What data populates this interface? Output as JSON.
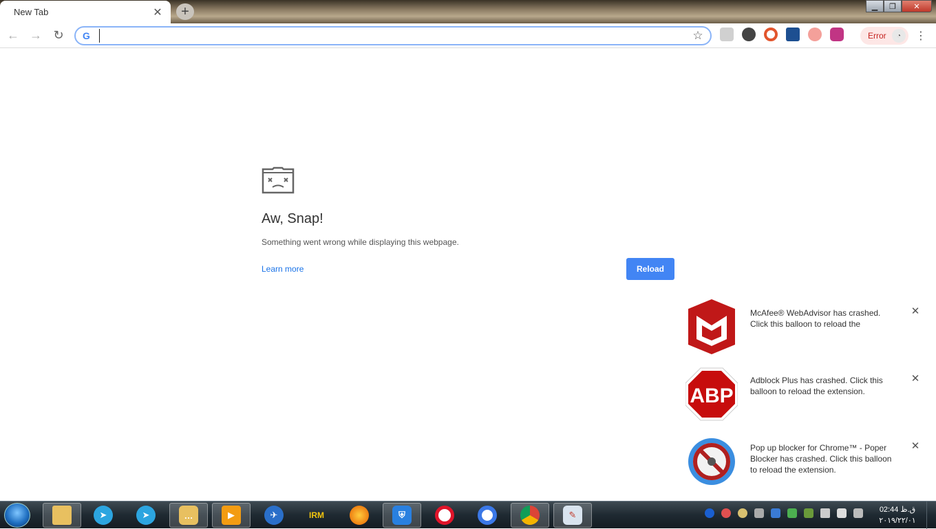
{
  "browser": {
    "tab": {
      "title": "New Tab",
      "close": "✕"
    },
    "new_tab": "+",
    "window": {
      "minimize": "▁",
      "maximize": "❐",
      "close": "✕"
    },
    "toolbar": {
      "back": "←",
      "forward": "→",
      "reload": "↻",
      "omnibox_value": "",
      "google": "G",
      "bookmark_star": "☆",
      "profile_label": "Error",
      "menu": "⋮"
    }
  },
  "error_page": {
    "title": "Aw, Snap!",
    "message": "Something went wrong while displaying this webpage.",
    "learn_more": "Learn more",
    "reload": "Reload"
  },
  "balloons": [
    {
      "text": "McAfee® WebAdvisor has crashed. Click this balloon to reload the",
      "icon": "mcafee-icon",
      "close": "✕"
    },
    {
      "text": "Adblock Plus has crashed. Click this balloon to reload the extension.",
      "icon": "abp-icon",
      "icon_text": "ABP",
      "close": "✕"
    },
    {
      "text": "Pop up blocker for Chrome™ - Poper Blocker has crashed. Click this balloon to reload the extension.",
      "icon": "popup-blocker-icon",
      "close": "✕"
    }
  ],
  "taskbar": {
    "clock_time": "02:44 ق.ظ",
    "clock_date": "۲۰۱۹/۲۲/۰۱",
    "irm_label": "IRM"
  },
  "colors": {
    "accent": "#4285f4",
    "link": "#1a73e8",
    "error_pill": "#fde7e6",
    "mcafee": "#c01818",
    "abp": "#c70d0d",
    "popup_ring": "#3b8ee0"
  }
}
